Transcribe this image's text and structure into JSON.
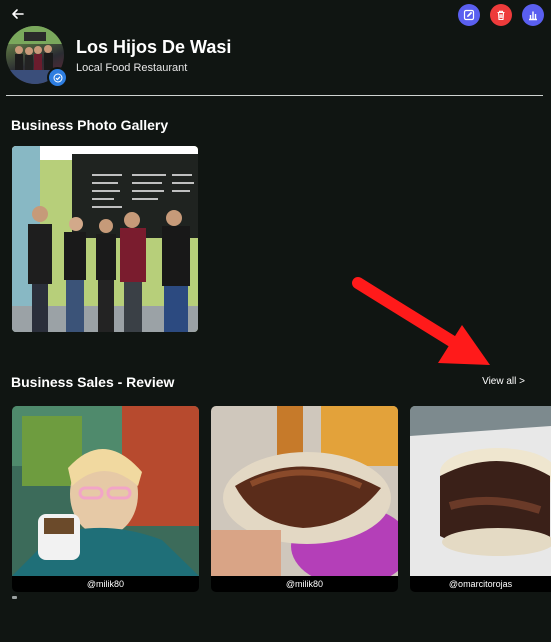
{
  "header": {
    "back_icon": "arrow-left-icon",
    "actions": [
      {
        "name": "edit",
        "icon": "pencil-icon",
        "color": "#5a5ff0"
      },
      {
        "name": "delete",
        "icon": "trash-icon",
        "color": "#ee3b3b"
      },
      {
        "name": "stats",
        "icon": "bar-chart-icon",
        "color": "#5a5ff0"
      }
    ]
  },
  "profile": {
    "name": "Los Hijos De Wasi",
    "category": "Local Food Restaurant",
    "verified_color": "#2d7de0"
  },
  "gallery": {
    "title": "Business Photo Gallery"
  },
  "reviews": {
    "title": "Business Sales - Review",
    "view_all": "View all >",
    "items": [
      {
        "handle": "@milik80"
      },
      {
        "handle": "@milik80"
      },
      {
        "handle": "@omarcitorojas"
      }
    ]
  },
  "annotation": {
    "color": "#ff1a1a"
  }
}
